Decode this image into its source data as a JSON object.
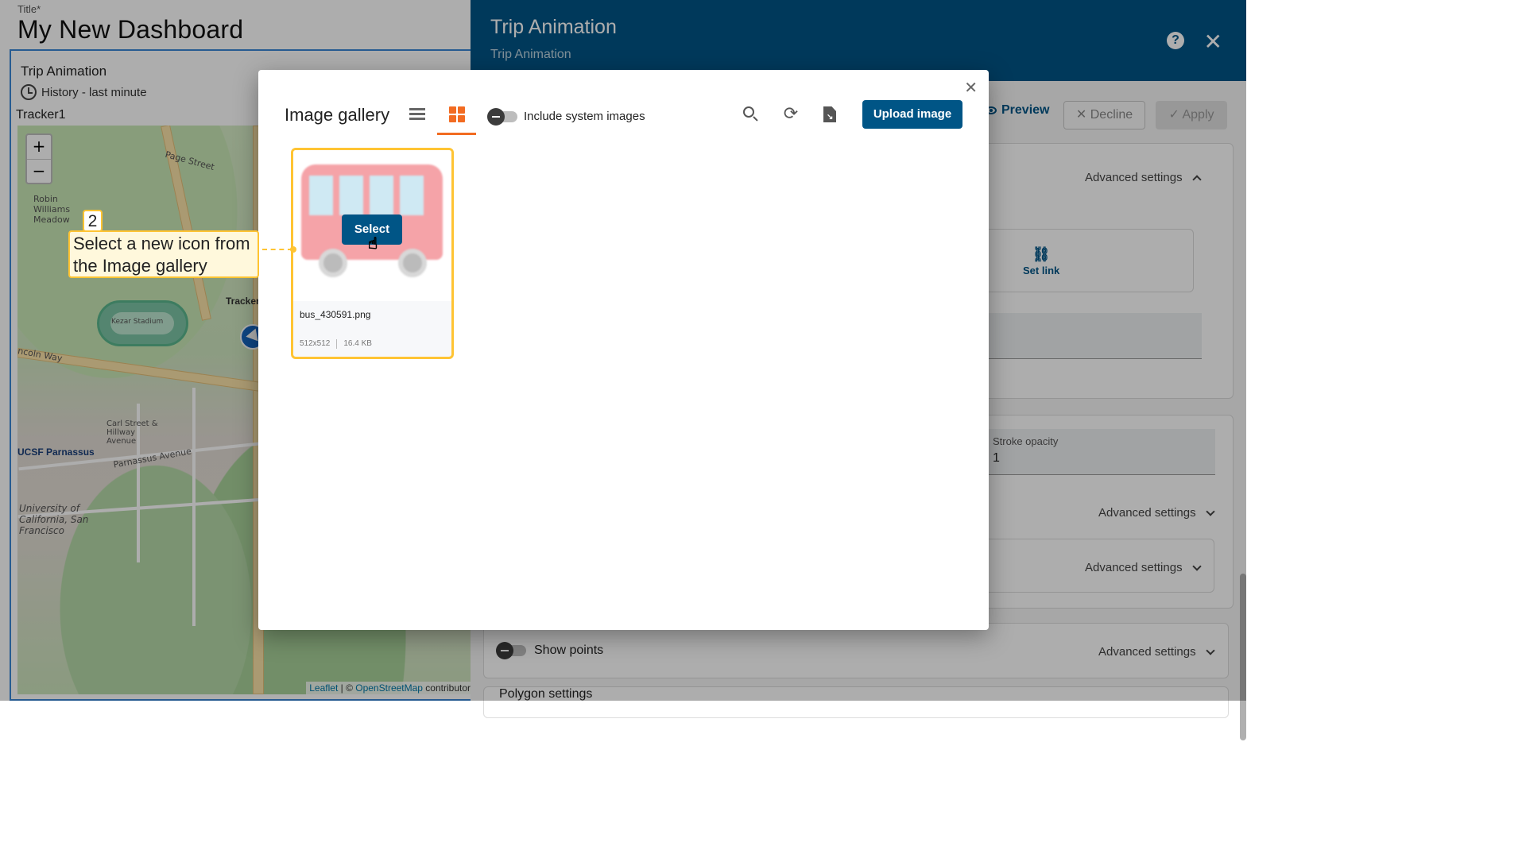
{
  "dashboard": {
    "title_label": "Title*",
    "title": "My New Dashboard",
    "widget": {
      "title": "Trip Animation",
      "timewindow": "History - last minute",
      "tracker_label": "Tracker1"
    },
    "map": {
      "zoom_in": "+",
      "zoom_out": "−",
      "labels": {
        "robin": "Robin Williams Meadow",
        "page_street": "Page Street",
        "kezar": "Kezar Stadium",
        "lincoln": "ncoln Way",
        "carl": "Carl Street & Hillway Avenue",
        "parnassus": "Parnassus Avenue",
        "ucsf": "UCSF Parnassus",
        "university": "University of California, San Francisco",
        "tracker": "Tracker"
      },
      "attribution": {
        "leaflet": "Leaflet",
        "sep": " | © ",
        "osm": "OpenStreetMap",
        "suffix": " contributors"
      }
    }
  },
  "panel": {
    "title": "Trip Animation",
    "subtitle": "Trip Animation",
    "help_icon": "help-icon",
    "actions": {
      "preview": "Preview",
      "decline": "Decline",
      "apply": "Apply"
    },
    "advanced_settings": "Advanced settings",
    "set_link": "Set link",
    "stroke_opacity": {
      "label": "Stroke opacity",
      "value": "1"
    },
    "show_points": "Show points",
    "polygon_settings": "Polygon settings"
  },
  "dialog": {
    "title": "Image gallery",
    "include_system_images": "Include system images",
    "upload_button": "Upload image",
    "images": [
      {
        "name": "bus_430591.png",
        "dimensions": "512x512",
        "size": "16.4 KB",
        "select_label": "Select"
      }
    ]
  },
  "tutorial": {
    "step": "2",
    "text": "Select a new icon from the Image gallery"
  },
  "colors": {
    "primary": "#005586",
    "accent": "#f26b21",
    "highlight": "#ffc433"
  }
}
